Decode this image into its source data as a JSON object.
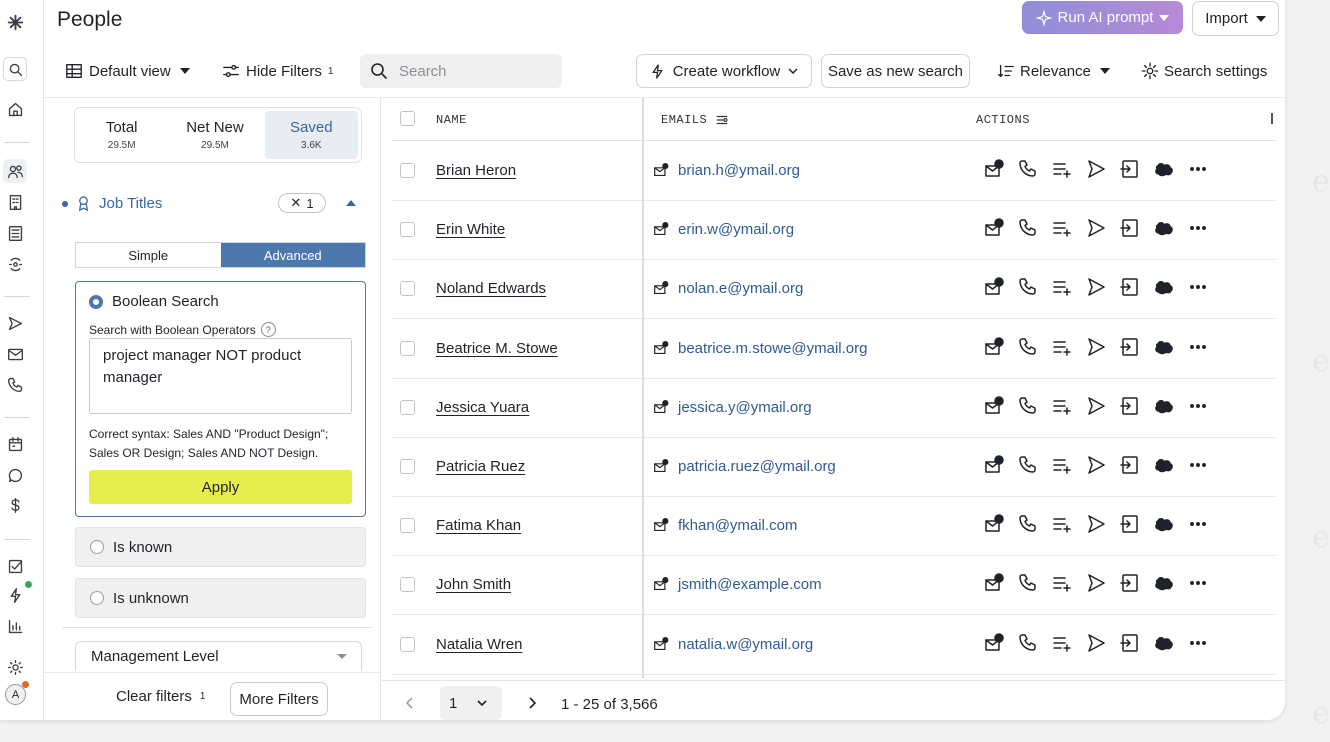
{
  "page": {
    "title": "People"
  },
  "header": {
    "run_ai_label": "Run AI prompt",
    "import_label": "Import"
  },
  "toolbar": {
    "default_view": "Default view",
    "hide_filters": "Hide Filters",
    "hide_filters_count": "1",
    "search_placeholder": "Search",
    "create_workflow": "Create workflow",
    "save_search": "Save as new search",
    "relevance": "Relevance",
    "search_settings": "Search settings"
  },
  "counts": {
    "total_label": "Total",
    "total_value": "29.5M",
    "netnew_label": "Net New",
    "netnew_value": "29.5M",
    "saved_label": "Saved",
    "saved_value": "3.6K"
  },
  "filters": {
    "job_titles_label": "Job Titles",
    "job_titles_count": "1",
    "simple_label": "Simple",
    "advanced_label": "Advanced",
    "boolean_label": "Boolean Search",
    "boolean_sub": "Search with Boolean Operators",
    "boolean_value": "project manager NOT product manager",
    "boolean_hint": "Correct syntax: Sales AND \"Product Design\"; Sales OR Design; Sales AND NOT Design.",
    "apply_label": "Apply",
    "is_known": "Is known",
    "is_unknown": "Is unknown",
    "management_level": "Management Level",
    "clear_filters": "Clear filters",
    "clear_count": "1",
    "more_filters": "More Filters"
  },
  "table": {
    "col_name": "NAME",
    "col_emails": "EMAILS",
    "col_actions": "ACTIONS",
    "rows": [
      {
        "name": "Brian Heron",
        "email": "brian.h@ymail.org"
      },
      {
        "name": "Erin White",
        "email": "erin.w@ymail.org"
      },
      {
        "name": "Noland Edwards",
        "email": "nolan.e@ymail.org"
      },
      {
        "name": "Beatrice M. Stowe",
        "email": "beatrice.m.stowe@ymail.org"
      },
      {
        "name": "Jessica Yuara",
        "email": "jessica.y@ymail.org"
      },
      {
        "name": "Patricia Ruez",
        "email": "patricia.ruez@ymail.org"
      },
      {
        "name": "Fatima Khan",
        "email": "fkhan@ymail.com"
      },
      {
        "name": "John Smith",
        "email": "jsmith@example.com"
      },
      {
        "name": "Natalia Wren",
        "email": "natalia.w@ymail.org"
      }
    ]
  },
  "pagination": {
    "page": "1",
    "range": "1 - 25 of 3,566"
  },
  "colors": {
    "accent": "#3a66a8",
    "apply": "#e6ee4d",
    "ai_gradient_start": "#8f8ed8",
    "ai_gradient_end": "#b68ad6"
  }
}
